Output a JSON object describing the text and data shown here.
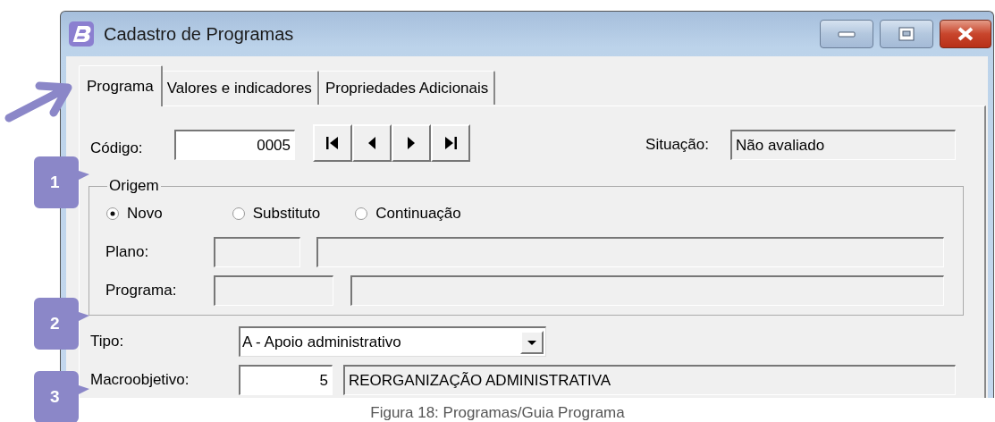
{
  "window": {
    "title": "Cadastro de Programas"
  },
  "tabs": [
    {
      "label": "Programa",
      "selected": true
    },
    {
      "label": "Valores e indicadores",
      "selected": false
    },
    {
      "label": "Propriedades Adicionais",
      "selected": false
    }
  ],
  "form": {
    "codigo": {
      "label": "Código:",
      "value": "0005"
    },
    "situacao": {
      "label": "Situação:",
      "value": "Não avaliado"
    },
    "origem": {
      "legend": "Origem",
      "options": [
        {
          "label": "Novo",
          "selected": true
        },
        {
          "label": "Substituto",
          "selected": false
        },
        {
          "label": "Continuação",
          "selected": false
        }
      ],
      "plano": {
        "label": "Plano:"
      },
      "programa": {
        "label": "Programa:"
      }
    },
    "tipo": {
      "label": "Tipo:",
      "value": "A - Apoio administrativo"
    },
    "macroobjetivo": {
      "label": "Macroobjetivo:",
      "code": "5",
      "description": "REORGANIZAÇÃO ADMINISTRATIVA"
    }
  },
  "callouts": [
    "1",
    "2",
    "3"
  ],
  "caption": "Figura 18: Programas/Guia Programa"
}
